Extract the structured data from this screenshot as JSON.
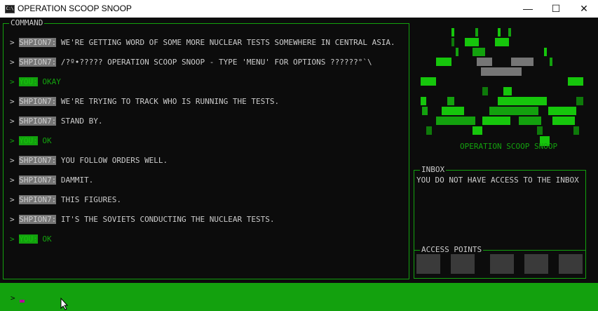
{
  "window": {
    "title": "OPERATION SCOOP SNOOP",
    "icon_text": "C:\\"
  },
  "command": {
    "title": "COMMAND",
    "messages": [
      {
        "prefix": "> ",
        "sender": "SHPION7:",
        "text": " WE'RE GETTING WORD OF SOME MORE NUCLEAR TESTS SOMEWHERE IN CENTRAL ASIA.",
        "you": false
      },
      {
        "prefix": "> ",
        "sender": "SHPION7:",
        "text": " /?º•????? OPERATION SCOOP SNOOP - TYPE 'MENU' FOR OPTIONS ??????°`\\",
        "you": false
      },
      {
        "prefix": "> ",
        "sender": "YOU:",
        "text": " OKAY",
        "you": true
      },
      {
        "prefix": "> ",
        "sender": "SHPION7:",
        "text": " WE'RE TRYING TO TRACK WHO IS RUNNING THE TESTS.",
        "you": false
      },
      {
        "prefix": "> ",
        "sender": "SHPION7:",
        "text": " STAND BY.",
        "you": false
      },
      {
        "prefix": "> ",
        "sender": "YOU:",
        "text": " OK",
        "you": true
      },
      {
        "prefix": "> ",
        "sender": "SHPION7:",
        "text": " YOU FOLLOW ORDERS WELL.",
        "you": false
      },
      {
        "prefix": "> ",
        "sender": "SHPION7:",
        "text": " DAMMIT.",
        "you": false
      },
      {
        "prefix": "> ",
        "sender": "SHPION7:",
        "text": " THIS FIGURES.",
        "you": false
      },
      {
        "prefix": "> ",
        "sender": "SHPION7:",
        "text": " IT'S THE SOVIETS CONDUCTING THE NUCLEAR TESTS.",
        "you": false
      },
      {
        "prefix": "> ",
        "sender": "YOU:",
        "text": " OK",
        "you": true
      }
    ]
  },
  "art": {
    "caption": "OPERATION SCOOP SNOOP"
  },
  "inbox": {
    "title": "INBOX",
    "message": "YOU DO NOT HAVE ACCESS TO THE INBOX"
  },
  "access_points": {
    "title": "ACCESS POINTS"
  },
  "input": {
    "prompt": ">"
  },
  "colors": {
    "accent": "#13a10e",
    "bright": "#16c60c",
    "background": "#0c0c0c",
    "text": "#cccccc",
    "tag": "#767676"
  }
}
